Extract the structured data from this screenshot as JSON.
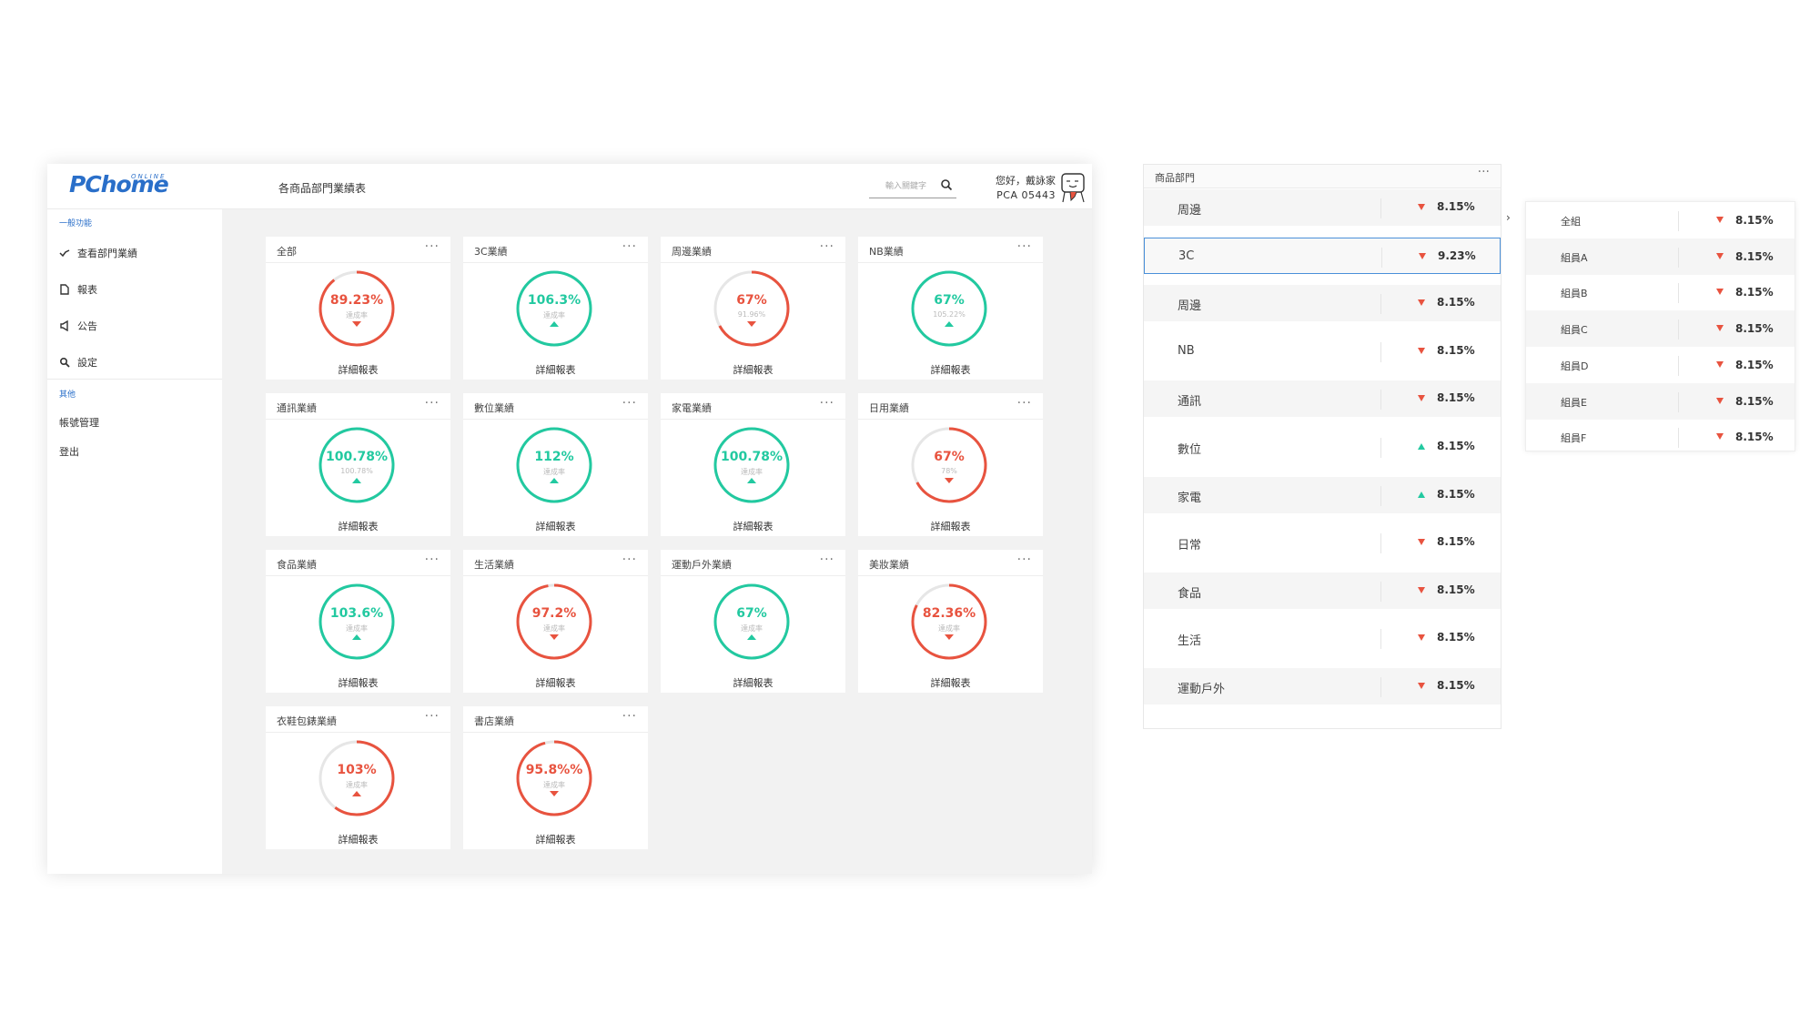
{
  "app": {
    "logo_text": "PChome",
    "logo_sub": "ONLINE",
    "page_title": "各商品部門業績表",
    "search_placeholder": "輸入關鍵字",
    "greeting": "您好，戴詠家",
    "user_id": "PCA 05443"
  },
  "sidebar": {
    "section1": "一般功能",
    "items": [
      {
        "label": "查看部門業績",
        "icon": "trend-icon"
      },
      {
        "label": "報表",
        "icon": "document-icon"
      },
      {
        "label": "公告",
        "icon": "megaphone-icon"
      },
      {
        "label": "設定",
        "icon": "settings-icon"
      }
    ],
    "section2": "其他",
    "items2": [
      {
        "label": "帳號管理"
      },
      {
        "label": "登出"
      }
    ]
  },
  "cards": [
    {
      "title": "全部",
      "pct": "89.23%",
      "sub": "達成率",
      "trend": "down",
      "status": "red",
      "fill": 0.8923,
      "link": "詳細報表"
    },
    {
      "title": "3C業績",
      "pct": "106.3%",
      "sub": "達成率",
      "trend": "up",
      "status": "green",
      "fill": 1.0,
      "link": "詳細報表"
    },
    {
      "title": "周邊業績",
      "pct": "67%",
      "sub": "91.96%",
      "trend": "down",
      "status": "red",
      "fill": 0.67,
      "link": "詳細報表"
    },
    {
      "title": "NB業績",
      "pct": "67%",
      "sub": "105.22%",
      "trend": "up",
      "status": "green",
      "fill": 1.0,
      "link": "詳細報表"
    },
    {
      "title": "通訊業績",
      "pct": "100.78%",
      "sub": "100.78%",
      "trend": "up",
      "status": "green",
      "fill": 1.0,
      "link": "詳細報表"
    },
    {
      "title": "數位業績",
      "pct": "112%",
      "sub": "達成率",
      "trend": "up",
      "status": "green",
      "fill": 1.0,
      "link": "詳細報表"
    },
    {
      "title": "家電業績",
      "pct": "100.78%",
      "sub": "達成率",
      "trend": "up",
      "status": "green",
      "fill": 1.0,
      "link": "詳細報表"
    },
    {
      "title": "日用業績",
      "pct": "67%",
      "sub": "78%",
      "trend": "down",
      "status": "red",
      "fill": 0.67,
      "link": "詳細報表"
    },
    {
      "title": "食品業績",
      "pct": "103.6%",
      "sub": "達成率",
      "trend": "up",
      "status": "green",
      "fill": 1.0,
      "link": "詳細報表"
    },
    {
      "title": "生活業績",
      "pct": "97.2%",
      "sub": "達成率",
      "trend": "down",
      "status": "red",
      "fill": 0.972,
      "link": "詳細報表"
    },
    {
      "title": "運動戶外業績",
      "pct": "67%",
      "sub": "達成率",
      "trend": "up",
      "status": "green",
      "fill": 1.0,
      "link": "詳細報表"
    },
    {
      "title": "美妝業績",
      "pct": "82.36%",
      "sub": "達成率",
      "trend": "down",
      "status": "red",
      "fill": 0.8236,
      "link": "詳細報表"
    },
    {
      "title": "衣鞋包錶業績",
      "pct": "103%",
      "sub": "達成率",
      "trend": "up",
      "status": "red",
      "fill": 0.6,
      "link": "詳細報表"
    },
    {
      "title": "書店業績",
      "pct": "95.8%%",
      "sub": "達成率",
      "trend": "down",
      "status": "red",
      "fill": 0.958,
      "link": "詳細報表"
    }
  ],
  "dept_panel": {
    "title": "商品部門",
    "rows": [
      {
        "name": "周邊",
        "value": "8.15%",
        "trend": "down"
      },
      {
        "name": "3C",
        "value": "9.23%",
        "trend": "down"
      },
      {
        "name": "周邊",
        "value": "8.15%",
        "trend": "down"
      },
      {
        "name": "NB",
        "value": "8.15%",
        "trend": "down"
      },
      {
        "name": "通訊",
        "value": "8.15%",
        "trend": "down"
      },
      {
        "name": "數位",
        "value": "8.15%",
        "trend": "up"
      },
      {
        "name": "家電",
        "value": "8.15%",
        "trend": "up"
      },
      {
        "name": "日常",
        "value": "8.15%",
        "trend": "down"
      },
      {
        "name": "食品",
        "value": "8.15%",
        "trend": "down"
      },
      {
        "name": "生活",
        "value": "8.15%",
        "trend": "down"
      },
      {
        "name": "運動戶外",
        "value": "8.15%",
        "trend": "down"
      }
    ]
  },
  "member_panel": {
    "rows": [
      {
        "name": "全組",
        "value": "8.15%",
        "trend": "down"
      },
      {
        "name": "組員A",
        "value": "8.15%",
        "trend": "down"
      },
      {
        "name": "組員B",
        "value": "8.15%",
        "trend": "down"
      },
      {
        "name": "組員C",
        "value": "8.15%",
        "trend": "down"
      },
      {
        "name": "組員D",
        "value": "8.15%",
        "trend": "down"
      },
      {
        "name": "組員E",
        "value": "8.15%",
        "trend": "down"
      },
      {
        "name": "組員F",
        "value": "8.15%",
        "trend": "down"
      }
    ]
  },
  "colors": {
    "red": "#e8533f",
    "green": "#22c9a0",
    "accent": "#2a6fc9",
    "track": "#e6e6e6"
  }
}
